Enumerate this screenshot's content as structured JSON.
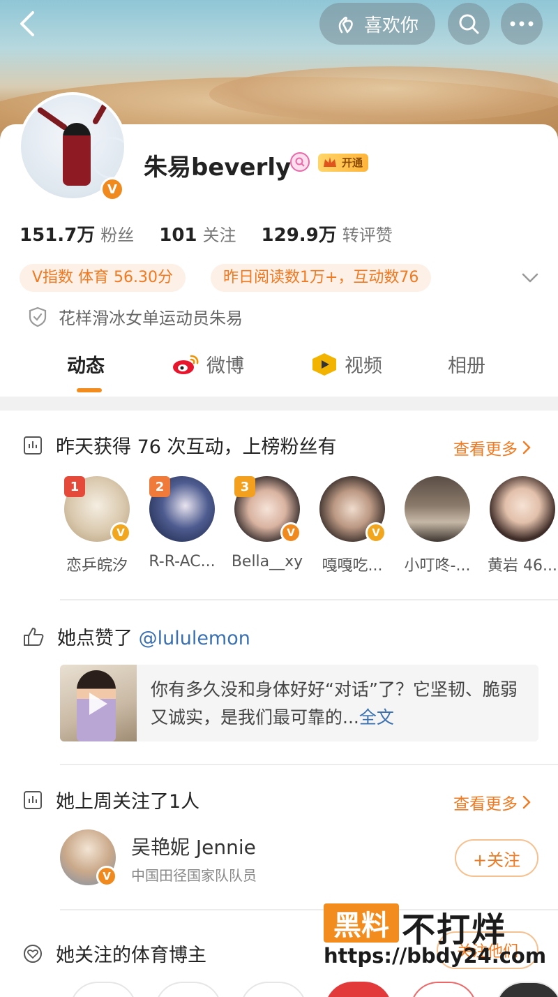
{
  "header": {
    "like_label": "喜欢你",
    "icons": [
      "back-arrow-icon",
      "hand-heart-icon",
      "search-icon",
      "more-dots-icon"
    ]
  },
  "profile": {
    "name": "朱易beverly",
    "vip_label": "开通",
    "stats": [
      {
        "value": "151.7万",
        "label": "粉丝"
      },
      {
        "value": "101",
        "label": "关注"
      },
      {
        "value": "129.9万",
        "label": "转评赞"
      }
    ],
    "pills": [
      "V指数 体育 56.30分",
      "昨日阅读数1万+，互动数76"
    ],
    "bio": "花样滑冰女单运动员朱易",
    "accent_color": "#f28c1e"
  },
  "tabs": [
    {
      "label": "动态",
      "active": true
    },
    {
      "label": "微博",
      "icon": "weibo-icon"
    },
    {
      "label": "视频",
      "icon": "video-icon"
    },
    {
      "label": "相册"
    }
  ],
  "fans_section": {
    "title": "昨天获得 76 次互动，上榜粉丝有",
    "see_more": "查看更多",
    "fans": [
      {
        "rank": "1",
        "name": "恋乒皖汐",
        "verified": true
      },
      {
        "rank": "2",
        "name": "R-R-AC...",
        "verified": false
      },
      {
        "rank": "3",
        "name": "Bella__xy",
        "verified": true
      },
      {
        "rank": "",
        "name": "嘎嘎吃...",
        "verified": true
      },
      {
        "rank": "",
        "name": "小叮咚-...",
        "verified": false
      },
      {
        "rank": "",
        "name": "黄岩 46...",
        "verified": false
      }
    ]
  },
  "liked_section": {
    "title_prefix": "她点赞了",
    "mention": "@lululemon",
    "text": "你有多久没和身体好好“对话”了？它坚韧、脆弱又诚实，是我们最可靠的...",
    "full_text_link": "全文"
  },
  "followed_section": {
    "title": "她上周关注了1人",
    "see_more": "查看更多",
    "user": {
      "name": "吴艳妮 Jennie",
      "desc": "中国田径国家队队员",
      "follow_label": "+关注"
    }
  },
  "sports_section": {
    "title": "她关注的体育博主",
    "button_label": "关注他们"
  },
  "watermark": {
    "box_text": "黑料",
    "big_text": "不打烊",
    "url": "https://bbdy24.com"
  }
}
